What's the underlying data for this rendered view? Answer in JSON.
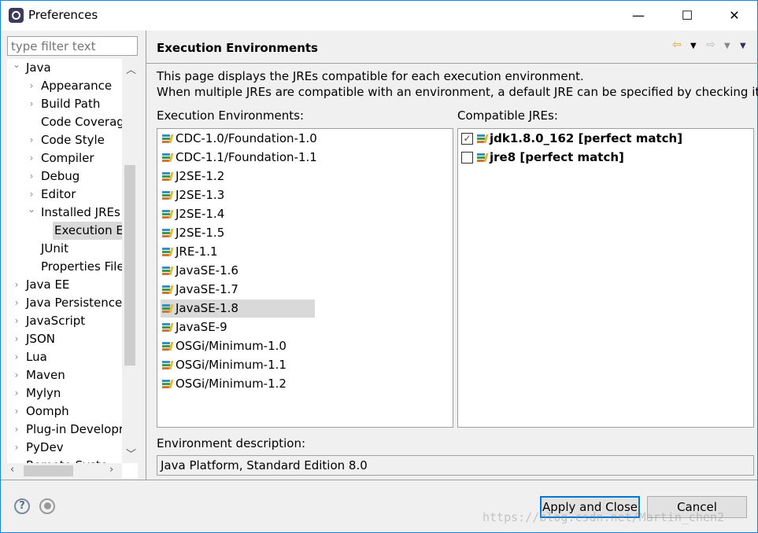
{
  "window": {
    "title": "Preferences",
    "minimize": "—",
    "maximize": "☐",
    "close": "✕"
  },
  "filter": {
    "placeholder": "type filter text"
  },
  "tree": [
    {
      "label": "Java",
      "level": 0,
      "twisty": "open"
    },
    {
      "label": "Appearance",
      "level": 1,
      "twisty": "closed"
    },
    {
      "label": "Build Path",
      "level": 1,
      "twisty": "closed"
    },
    {
      "label": "Code Coverag",
      "level": 1,
      "twisty": "none"
    },
    {
      "label": "Code Style",
      "level": 1,
      "twisty": "closed"
    },
    {
      "label": "Compiler",
      "level": 1,
      "twisty": "closed"
    },
    {
      "label": "Debug",
      "level": 1,
      "twisty": "closed"
    },
    {
      "label": "Editor",
      "level": 1,
      "twisty": "closed"
    },
    {
      "label": "Installed JREs",
      "level": 1,
      "twisty": "open"
    },
    {
      "label": "Execution E",
      "level": 2,
      "twisty": "none",
      "selected": true
    },
    {
      "label": "JUnit",
      "level": 1,
      "twisty": "none"
    },
    {
      "label": "Properties File",
      "level": 1,
      "twisty": "none"
    },
    {
      "label": "Java EE",
      "level": 0,
      "twisty": "closed"
    },
    {
      "label": "Java Persistence",
      "level": 0,
      "twisty": "closed"
    },
    {
      "label": "JavaScript",
      "level": 0,
      "twisty": "closed"
    },
    {
      "label": "JSON",
      "level": 0,
      "twisty": "closed"
    },
    {
      "label": "Lua",
      "level": 0,
      "twisty": "closed"
    },
    {
      "label": "Maven",
      "level": 0,
      "twisty": "closed"
    },
    {
      "label": "Mylyn",
      "level": 0,
      "twisty": "closed"
    },
    {
      "label": "Oomph",
      "level": 0,
      "twisty": "closed"
    },
    {
      "label": "Plug-in Developr",
      "level": 0,
      "twisty": "closed"
    },
    {
      "label": "PyDev",
      "level": 0,
      "twisty": "closed"
    },
    {
      "label": "Remote Syste",
      "level": 0,
      "twisty": "closed"
    }
  ],
  "page": {
    "title": "Execution Environments",
    "description_line1": "This page displays the JREs compatible for each execution environment.",
    "description_line2": "When multiple JREs are compatible with an environment, a default JRE can be specified by checking it.",
    "env_label": "Execution Environments:",
    "jre_label": "Compatible JREs:",
    "environments": [
      "CDC-1.0/Foundation-1.0",
      "CDC-1.1/Foundation-1.1",
      "J2SE-1.2",
      "J2SE-1.3",
      "J2SE-1.4",
      "J2SE-1.5",
      "JRE-1.1",
      "JavaSE-1.6",
      "JavaSE-1.7",
      "JavaSE-1.8",
      "JavaSE-9",
      "OSGi/Minimum-1.0",
      "OSGi/Minimum-1.1",
      "OSGi/Minimum-1.2"
    ],
    "selected_environment": "JavaSE-1.8",
    "jres": [
      {
        "label": "jdk1.8.0_162 [perfect match]",
        "checked": true
      },
      {
        "label": "jre8 [perfect match]",
        "checked": false
      }
    ],
    "env_desc_label": "Environment description:",
    "env_desc_value": "Java Platform, Standard Edition 8.0"
  },
  "buttons": {
    "apply_close": "Apply and Close",
    "cancel": "Cancel"
  },
  "watermark": "https://blog.csdn.net/Martin_chen2",
  "icons": {
    "back": "arrow-left-icon",
    "forward": "arrow-right-icon",
    "help": "help-icon",
    "oomph": "record-icon",
    "jre": "library-icon"
  }
}
